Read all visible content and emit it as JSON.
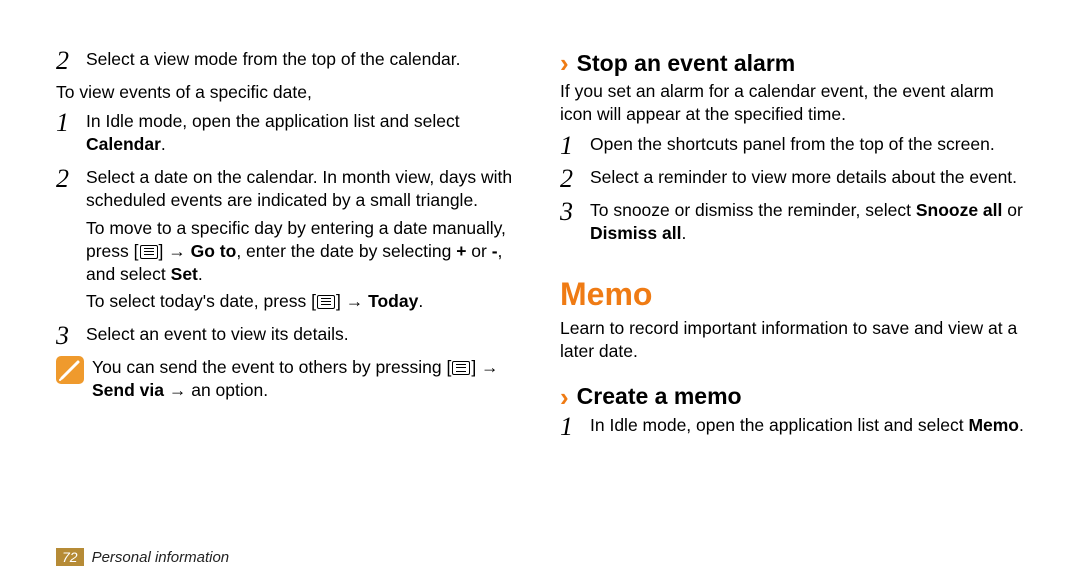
{
  "left": {
    "step2": "Select a view mode from the top of the calendar.",
    "intro": "To view events of a specific date,",
    "sub1_pre": "In Idle mode, open the application list and select ",
    "sub1_bold": "Calendar",
    "sub2": "Select a date on the calendar. In month view, days with scheduled events are indicated by a small triangle.",
    "sub2b_pre": "To move to a specific day by entering a date manually, press [",
    "sub2b_mid1": "] → ",
    "sub2b_goto": "Go to",
    "sub2b_mid2": ", enter the date by selecting ",
    "sub2b_plus": "+",
    "sub2b_or": " or ",
    "sub2b_minus": "-",
    "sub2b_mid3": ", and select ",
    "sub2b_set": "Set",
    "sub2c_pre": "To select today's date, press [",
    "sub2c_mid": "] → ",
    "sub2c_today": "Today",
    "sub3": "Select an event to view its details.",
    "note_pre": "You can send the event to others by pressing [",
    "note_mid": "] → ",
    "note_sendvia": "Send via",
    "note_tail": " → an option."
  },
  "right": {
    "h_stop": "Stop an event alarm",
    "stop_intro": "If you set an alarm for a calendar event, the event alarm icon will appear at the specified time.",
    "s1": "Open the shortcuts panel from the top of the screen.",
    "s2": "Select a reminder to view more details about the event.",
    "s3_pre": "To snooze or dismiss the reminder, select ",
    "s3_snooze": "Snooze all",
    "s3_or": " or ",
    "s3_dismiss": "Dismiss all",
    "h_memo": "Memo",
    "memo_intro": "Learn to record important information to save and view at a later date.",
    "h_create": "Create a memo",
    "c1_pre": "In Idle mode, open the application list and select ",
    "c1_bold": "Memo"
  },
  "footer": {
    "page": "72",
    "section": "Personal information"
  }
}
